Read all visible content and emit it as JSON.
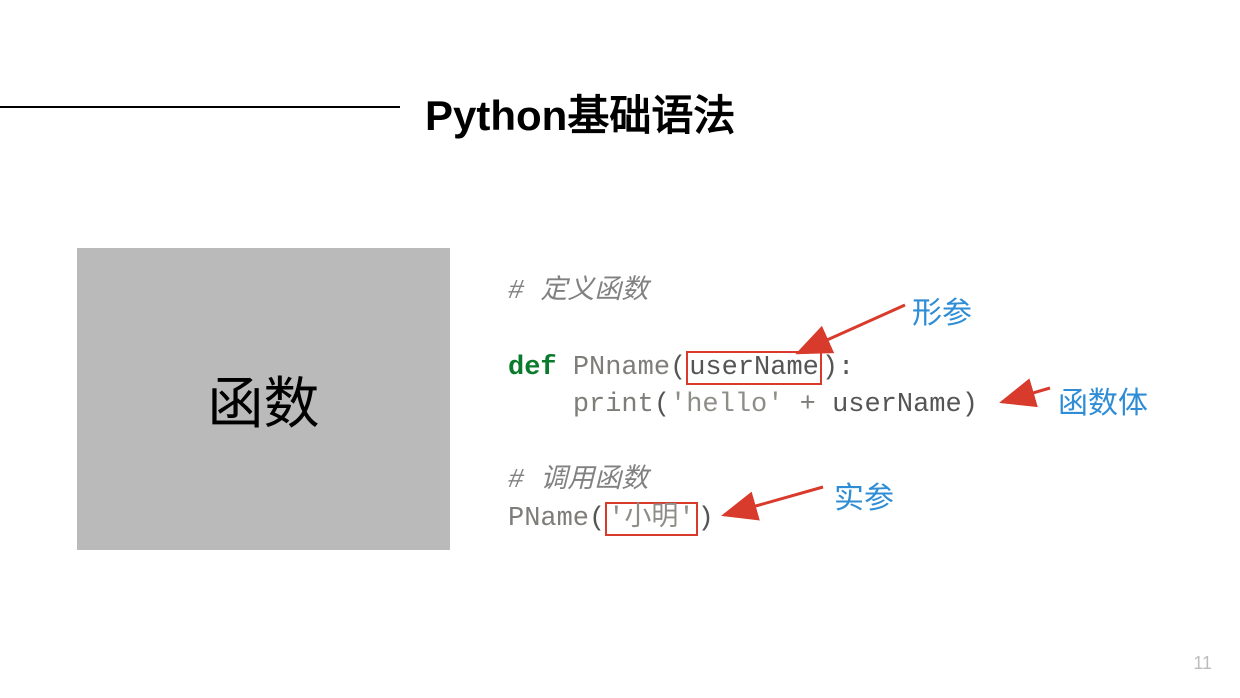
{
  "header": {
    "title": "Python基础语法"
  },
  "leftBox": {
    "label": "函数"
  },
  "code": {
    "comment1": "# 定义函数",
    "defKw": "def",
    "fnDef": "PNname",
    "paramBoxed": "userName",
    "defTail": "):",
    "indent": "    ",
    "printCall": "print",
    "strHello": "'hello'",
    "plusOp": " + ",
    "ident": "userName",
    "closeParen": ")",
    "comment2": "# 调用函数",
    "callFn": "PName",
    "callArgBoxed": "'小明'",
    "callClose": ")"
  },
  "annotations": {
    "formalParam": "形参",
    "funcBody": "函数体",
    "actualParam": "实参"
  },
  "pageNumber": "11"
}
